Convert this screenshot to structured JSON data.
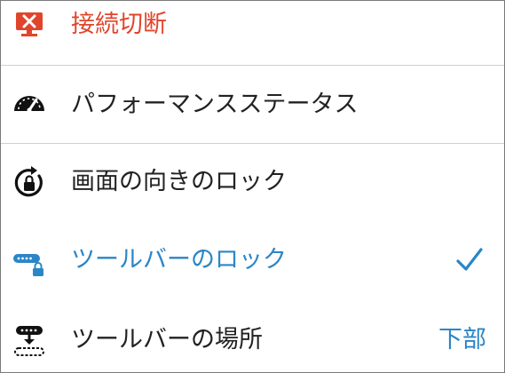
{
  "colors": {
    "danger": "#e0452b",
    "active": "#2b86c6",
    "text": "#222222",
    "value": "#2b86c6"
  },
  "menu": {
    "items": [
      {
        "label": "接続切断",
        "icon": "disconnect-monitor-icon"
      },
      {
        "label": "パフォーマンスステータス",
        "icon": "speedometer-icon"
      },
      {
        "label": "画面の向きのロック",
        "icon": "rotation-lock-icon"
      },
      {
        "label": "ツールバーのロック",
        "icon": "toolbar-lock-icon",
        "checked": true
      },
      {
        "label": "ツールバーの場所",
        "icon": "toolbar-position-icon",
        "value": "下部"
      }
    ]
  }
}
